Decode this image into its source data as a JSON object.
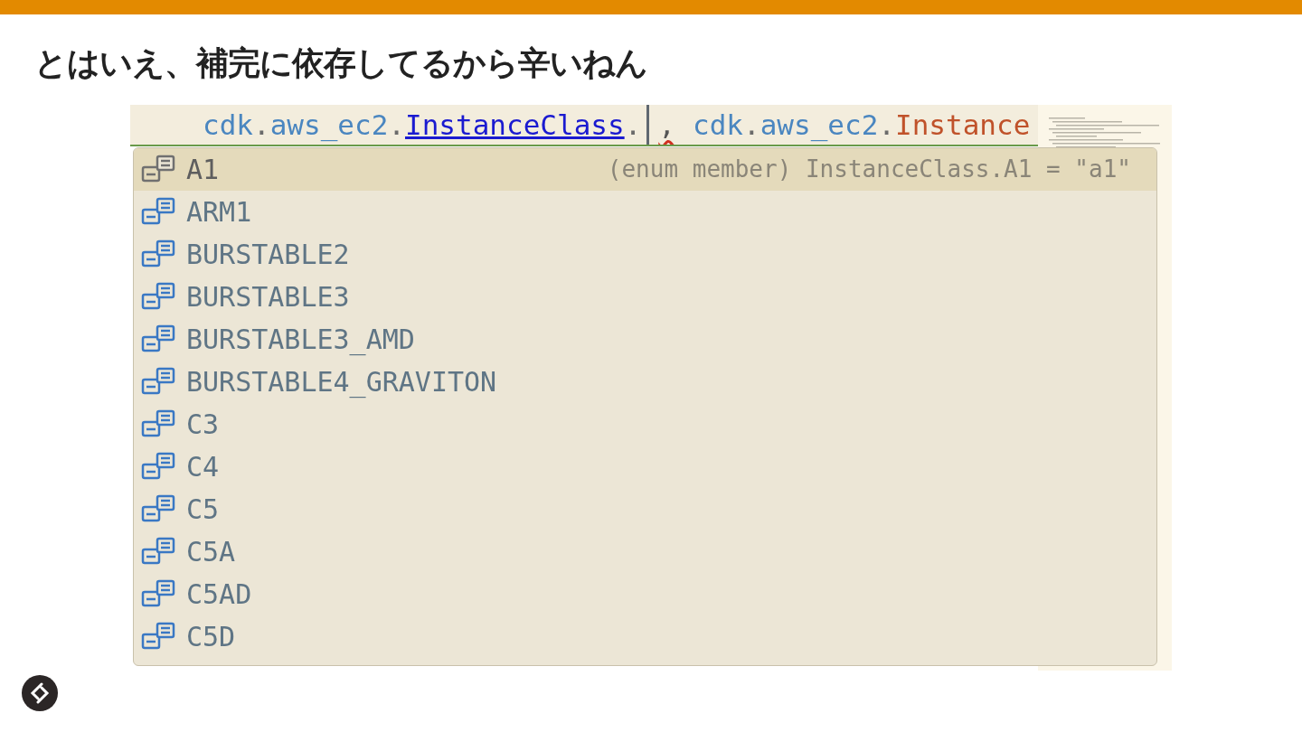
{
  "title": "とはいえ、補完に依存してるから辛いねん",
  "code_line": [
    {
      "text": "cdk",
      "kind": "name"
    },
    {
      "text": ".",
      "kind": "punct"
    },
    {
      "text": "aws_ec2",
      "kind": "name"
    },
    {
      "text": ".",
      "kind": "punct"
    },
    {
      "text": "InstanceClass",
      "kind": "link"
    },
    {
      "text": ".",
      "kind": "punct"
    },
    {
      "kind": "cursor"
    },
    {
      "text": ",",
      "kind": "error"
    },
    {
      "text": "cdk",
      "kind": "name"
    },
    {
      "text": ".",
      "kind": "punct"
    },
    {
      "text": "aws_ec2",
      "kind": "name"
    },
    {
      "text": ".",
      "kind": "punct"
    },
    {
      "text": "Instance",
      "kind": "type"
    }
  ],
  "completions": [
    {
      "label": "A1",
      "selected": true,
      "detail": "(enum member) InstanceClass.A1 = \"a1\""
    },
    {
      "label": "ARM1",
      "selected": false
    },
    {
      "label": "BURSTABLE2",
      "selected": false
    },
    {
      "label": "BURSTABLE3",
      "selected": false
    },
    {
      "label": "BURSTABLE3_AMD",
      "selected": false
    },
    {
      "label": "BURSTABLE4_GRAVITON",
      "selected": false
    },
    {
      "label": "C3",
      "selected": false
    },
    {
      "label": "C4",
      "selected": false
    },
    {
      "label": "C5",
      "selected": false
    },
    {
      "label": "C5A",
      "selected": false
    },
    {
      "label": "C5AD",
      "selected": false
    },
    {
      "label": "C5D",
      "selected": false
    }
  ]
}
